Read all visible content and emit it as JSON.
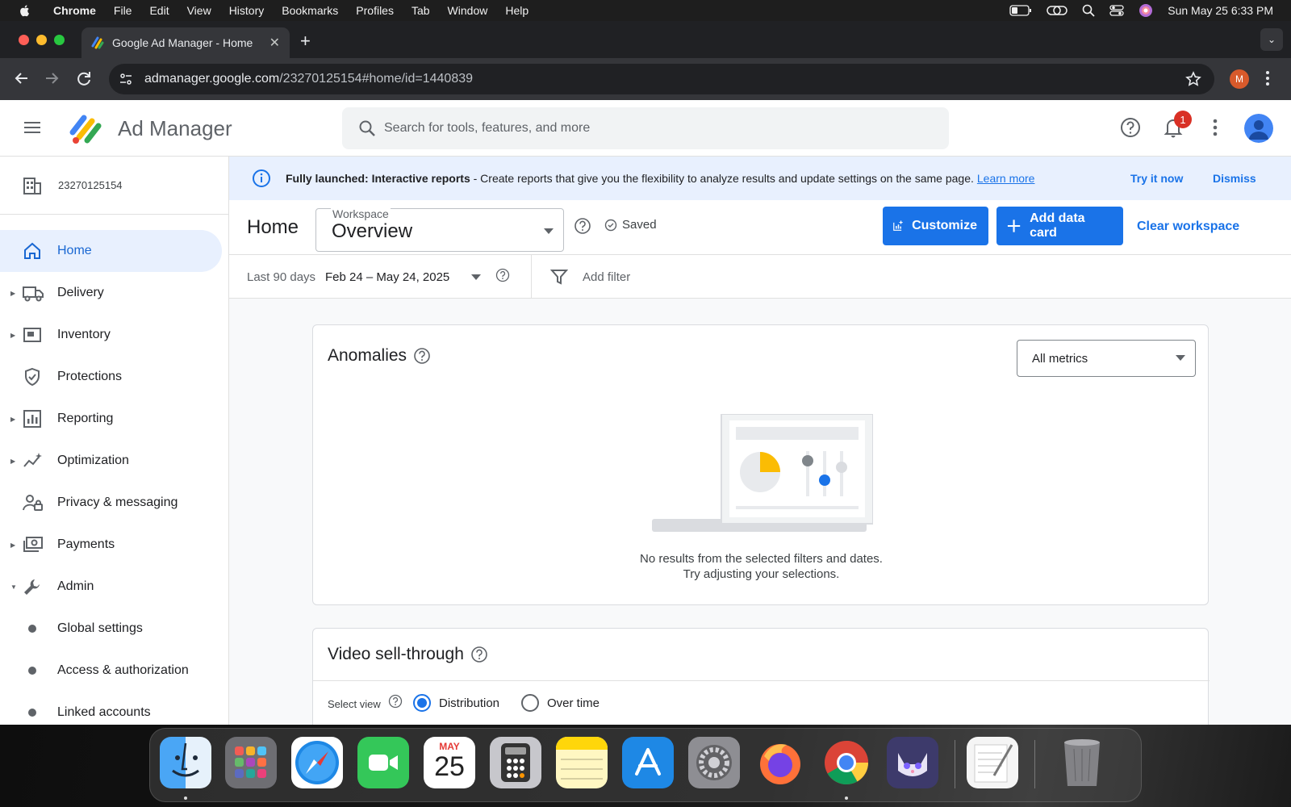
{
  "menubar": {
    "app_name": "Chrome",
    "items": [
      "File",
      "Edit",
      "View",
      "History",
      "Bookmarks",
      "Profiles",
      "Tab",
      "Window",
      "Help"
    ],
    "datetime": "Sun May 25  6:33 PM"
  },
  "browser": {
    "tab_title": "Google Ad Manager - Home",
    "url_host": "admanager.google.com",
    "url_path": "/23270125154#home/id=1440839",
    "profile_initial": "M"
  },
  "header": {
    "app_name": "Ad Manager",
    "search_placeholder": "Search for tools, features, and more",
    "notification_count": "1"
  },
  "sidebar": {
    "network_id": "23270125154",
    "items": [
      {
        "label": "Home",
        "icon": "home-icon",
        "active": true
      },
      {
        "label": "Delivery",
        "icon": "truck-icon"
      },
      {
        "label": "Inventory",
        "icon": "inventory-icon"
      },
      {
        "label": "Protections",
        "icon": "shield-icon"
      },
      {
        "label": "Reporting",
        "icon": "bar-chart-icon"
      },
      {
        "label": "Optimization",
        "icon": "optimization-icon"
      },
      {
        "label": "Privacy & messaging",
        "icon": "privacy-icon"
      },
      {
        "label": "Payments",
        "icon": "payments-icon"
      },
      {
        "label": "Admin",
        "icon": "wrench-icon",
        "expanded": true
      },
      {
        "label": "Global settings"
      },
      {
        "label": "Access & authorization"
      },
      {
        "label": "Linked accounts"
      }
    ]
  },
  "banner": {
    "bold": "Fully launched: Interactive reports",
    "text": " - Create reports that give you the flexibility to analyze results and update settings on the same page.",
    "learn_more": "Learn more",
    "try_now": "Try it now",
    "dismiss": "Dismiss"
  },
  "workspace": {
    "page_title": "Home",
    "label": "Workspace",
    "value": "Overview",
    "status": "Saved",
    "customize": "Customize",
    "add_card": "Add data card",
    "clear": "Clear workspace"
  },
  "filters": {
    "range_label": "Last 90 days",
    "range_value": "Feb 24 – May 24, 2025",
    "add_filter": "Add filter"
  },
  "anomalies": {
    "title": "Anomalies",
    "metric_select": "All metrics",
    "empty_line1": "No results from the selected filters and dates.",
    "empty_line2": "Try adjusting your selections."
  },
  "video": {
    "title": "Video sell-through",
    "select_view": "Select view",
    "option_distribution": "Distribution",
    "option_over_time": "Over time",
    "selected": "Distribution"
  },
  "dock": {
    "calendar_month": "MAY",
    "calendar_day": "25"
  },
  "colors": {
    "primary": "#1a73e8",
    "banner_bg": "#e8f0fe",
    "badge": "#d93025"
  }
}
